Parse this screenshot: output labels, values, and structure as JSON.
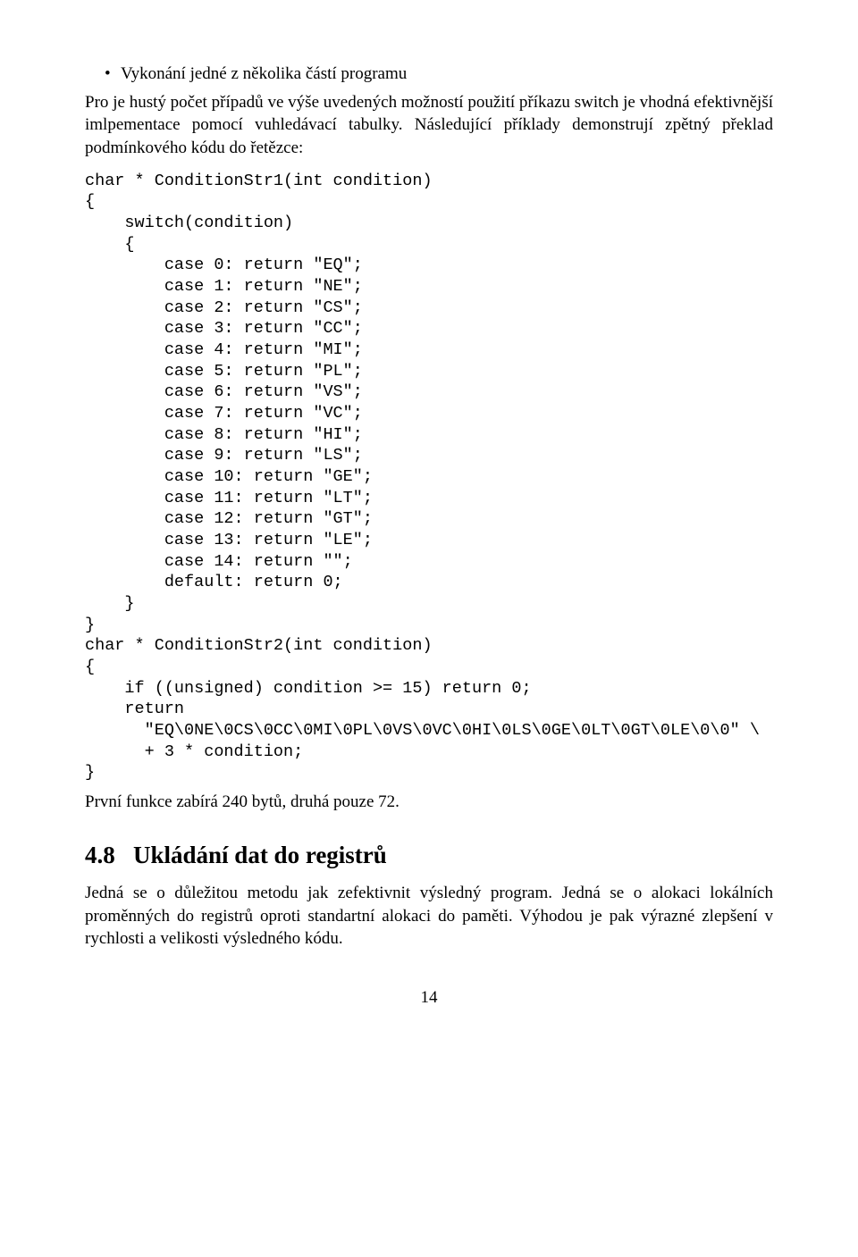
{
  "bullet1": "Vykonání jedné z několika částí programu",
  "para1": "Pro je hustý počet případů ve výše uvedených možností použití příkazu switch je vhodná efektivnější imlpementace pomocí vuhledávací tabulky. Následující příklady demonstrují zpětný překlad podmínkového kódu do řetězce:",
  "code1": "char * ConditionStr1(int condition)\n{\n    switch(condition)\n    {\n        case 0: return \"EQ\";\n        case 1: return \"NE\";\n        case 2: return \"CS\";\n        case 3: return \"CC\";\n        case 4: return \"MI\";\n        case 5: return \"PL\";\n        case 6: return \"VS\";\n        case 7: return \"VC\";\n        case 8: return \"HI\";\n        case 9: return \"LS\";\n        case 10: return \"GE\";\n        case 11: return \"LT\";\n        case 12: return \"GT\";\n        case 13: return \"LE\";\n        case 14: return \"\";\n        default: return 0;\n    }\n}\nchar * ConditionStr2(int condition)\n{\n    if ((unsigned) condition >= 15) return 0;\n    return\n      \"EQ\\0NE\\0CS\\0CC\\0MI\\0PL\\0VS\\0VC\\0HI\\0LS\\0GE\\0LT\\0GT\\0LE\\0\\0\" \\\n      + 3 * condition;\n}",
  "para2": "První funkce zabírá 240 bytů, druhá pouze 72.",
  "heading_num": "4.8",
  "heading_text": "Ukládání dat do registrů",
  "para3": "Jedná se o důležitou metodu jak zefektivnit výsledný program. Jedná se o alokaci lokálních proměnných do registrů oproti standartní alokaci do paměti. Výhodou je pak výrazné zlepšení v rychlosti a velikosti výsledného kódu.",
  "pagenum": "14"
}
